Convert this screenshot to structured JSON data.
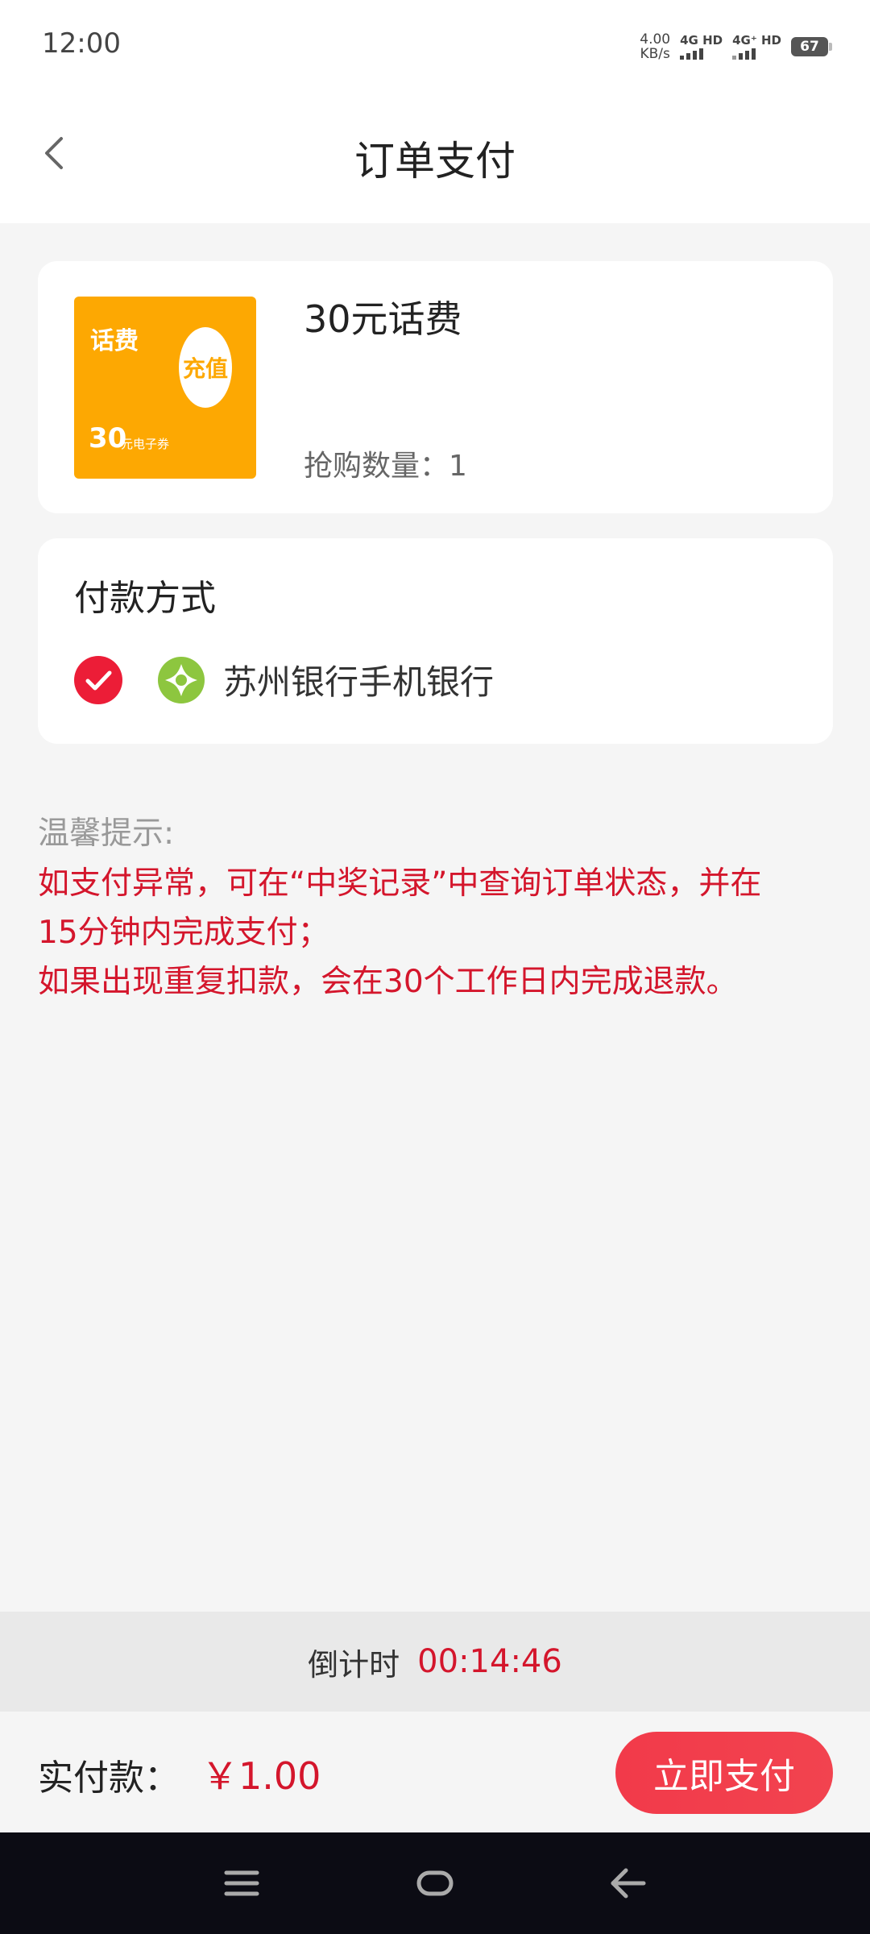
{
  "status_bar": {
    "time": "12:00",
    "net_speed_value": "4.00",
    "net_speed_unit": "KB/s",
    "sim1_label": "4G HD",
    "sim2_label": "4G⁺ HD",
    "battery": "67"
  },
  "header": {
    "title": "订单支付",
    "back_icon": "chevron-left-icon"
  },
  "product": {
    "thumb_title": "话费",
    "thumb_badge": "充值",
    "thumb_amount": "30",
    "thumb_desc": "元电子券",
    "name": "30元话费",
    "quantity_text": "抢购数量：1"
  },
  "payment": {
    "title": "付款方式",
    "method_name": "苏州银行手机银行",
    "selected": true,
    "check_color": "#ec1d37",
    "bank_icon_color": "#8dc63f"
  },
  "tips": {
    "title": "温馨提示:",
    "lines": [
      "如支付异常，可在“中奖记录”中查询订单状态，并在",
      "15分钟内完成支付；",
      "如果出现重复扣款，会在30个工作日内完成退款。"
    ]
  },
  "countdown": {
    "label": "倒计时",
    "value": "00:14:46"
  },
  "footer": {
    "amount_label": "实付款：",
    "amount_value": "￥1.00",
    "pay_button": "立即支付",
    "accent_color": "#d4162c"
  },
  "system_nav": {
    "menu_icon": "menu-icon",
    "home_icon": "home-icon",
    "back_icon": "back-arrow-icon"
  }
}
